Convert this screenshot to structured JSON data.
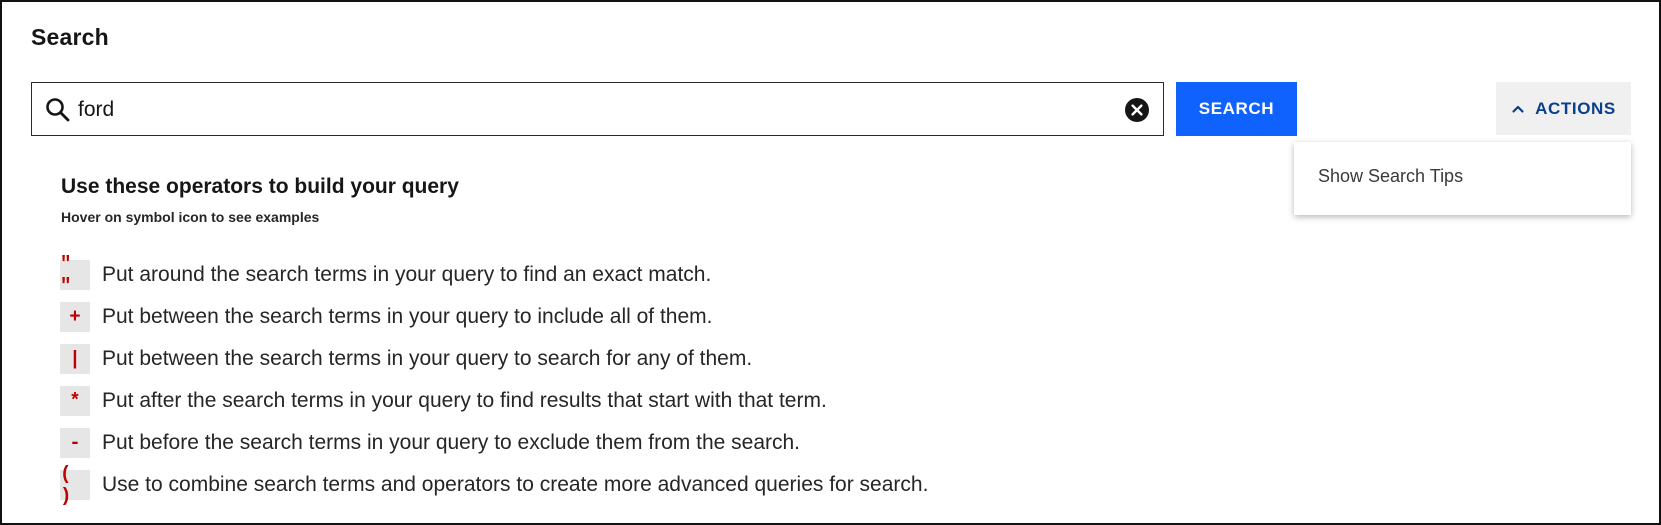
{
  "page_title": "Search",
  "search": {
    "value": "ford",
    "placeholder": "",
    "button_label": "SEARCH"
  },
  "actions": {
    "label": "ACTIONS",
    "menu_items": [
      "Show Search Tips"
    ]
  },
  "tips": {
    "heading": "Use these operators to build your query",
    "subheading": "Hover on symbol icon to see examples",
    "operators": [
      {
        "symbol": "\" \"",
        "description": "Put around the search terms in your query to find an exact match."
      },
      {
        "symbol": "+",
        "description": "Put between the search terms in your query to include all of them."
      },
      {
        "symbol": "|",
        "description": "Put between the search terms in your query to search for any of them."
      },
      {
        "symbol": "*",
        "description": "Put after the search terms in your query to find results that start with that term."
      },
      {
        "symbol": "-",
        "description": "Put before the search terms in your query to exclude them from the search."
      },
      {
        "symbol": "( )",
        "description": "Use to combine search terms and operators to create more advanced queries for search."
      }
    ]
  },
  "icons": {
    "search": "search-icon",
    "clear": "close-circle-icon",
    "actions_chevron": "chevron-up-icon"
  },
  "colors": {
    "primary": "#0f62fe",
    "actions_text": "#0a3f8f",
    "operator_symbol": "#c00000",
    "operator_bg": "#e6e6e6"
  }
}
